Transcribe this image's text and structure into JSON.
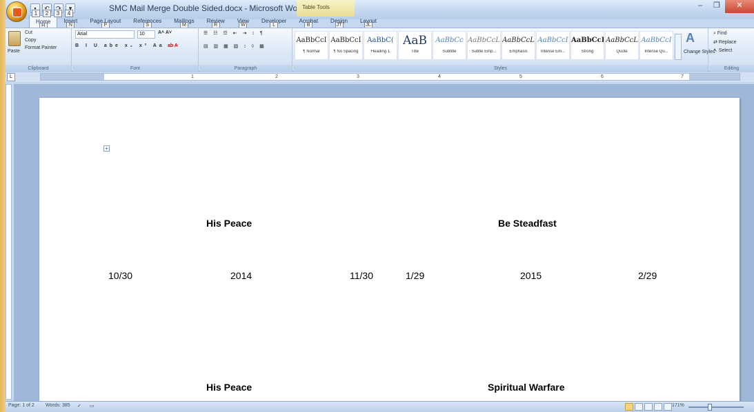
{
  "window": {
    "title": "SMC Mail Merge Double Sided.docx",
    "title_separator": "-",
    "app": "Microsoft Word",
    "contextual_tab": "Table Tools",
    "minimize": "–",
    "maximize": "❐",
    "close": "✕"
  },
  "qat_keytips": [
    "1",
    "2",
    "3",
    "4"
  ],
  "ribbon_tabs": [
    {
      "label": "Home",
      "keytip": "H"
    },
    {
      "label": "Insert",
      "keytip": "N"
    },
    {
      "label": "Page Layout",
      "keytip": "P"
    },
    {
      "label": "References",
      "keytip": "S"
    },
    {
      "label": "Mailings",
      "keytip": "M"
    },
    {
      "label": "Review",
      "keytip": "R"
    },
    {
      "label": "View",
      "keytip": "W"
    },
    {
      "label": "Developer",
      "keytip": "L"
    },
    {
      "label": "Acrobat",
      "keytip": "B"
    },
    {
      "label": "Design",
      "keytip": "JT"
    },
    {
      "label": "Layout",
      "keytip": "JL"
    }
  ],
  "clipboard": {
    "label": "Clipboard",
    "paste": "Paste",
    "cut": "Cut",
    "copy": "Copy",
    "format_painter": "Format Painter"
  },
  "font": {
    "label": "Font",
    "name": "Arial",
    "size": "10"
  },
  "paragraph": {
    "label": "Paragraph"
  },
  "styles": {
    "label": "Styles",
    "items": [
      {
        "sample": "AaBbCcI",
        "name": "¶ Normal"
      },
      {
        "sample": "AaBbCcI",
        "name": "¶ No Spacing"
      },
      {
        "sample": "AaBbC(",
        "name": "Heading 1"
      },
      {
        "sample": "AaB",
        "name": "Title"
      },
      {
        "sample": "AaBbCc",
        "name": "Subtitle"
      },
      {
        "sample": "AaBbCcL",
        "name": "Subtle Emp..."
      },
      {
        "sample": "AaBbCcL",
        "name": "Emphasis"
      },
      {
        "sample": "AaBbCcI",
        "name": "Intense Em..."
      },
      {
        "sample": "AaBbCcI",
        "name": "Strong"
      },
      {
        "sample": "AaBbCcL",
        "name": "Quote"
      },
      {
        "sample": "AaBbCcI",
        "name": "Intense Qu..."
      }
    ],
    "change_styles": "Change Styles"
  },
  "editing": {
    "label": "Editing",
    "find": "Find",
    "replace": "Replace",
    "select": "Select"
  },
  "ruler": {
    "corner": "L",
    "numbers": [
      "1",
      "2",
      "3",
      "4",
      "5",
      "6",
      "7"
    ]
  },
  "document": {
    "row1": {
      "left_title": "His Peace",
      "right_title": "Be Steadfast",
      "values": [
        "10/30",
        "2014",
        "11/30",
        "1/29",
        "2015",
        "2/29"
      ]
    },
    "row2": {
      "left_title": "His Peace",
      "right_title": "Spiritual Warfare"
    }
  },
  "status": {
    "page": "Page: 1 of 2",
    "words": "Words: 385",
    "zoom": "171%"
  }
}
